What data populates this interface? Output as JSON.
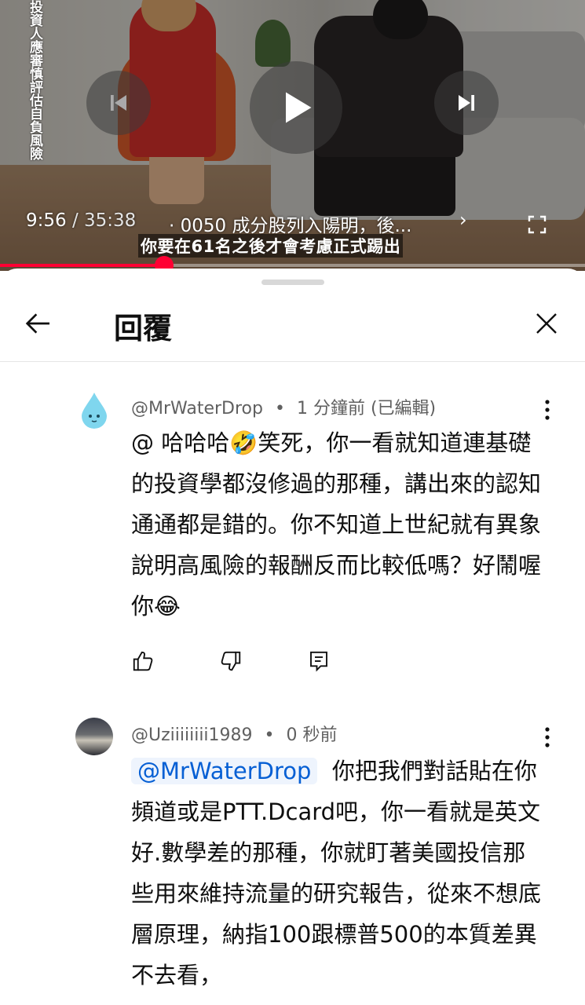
{
  "video": {
    "overlay_vertical_text": "投資人應審慎評估自負風險",
    "current_time": "9:56",
    "duration": " / 35:38",
    "chapter": "· 0050 成分股列入陽明，後...",
    "chapter_chevron": "›",
    "subtitle": "你要在61名之後才會考慮正式踢出",
    "progress_fraction": 0.28,
    "buttons": {
      "prev": "previous",
      "play": "play",
      "next": "next"
    }
  },
  "panel": {
    "title": "回覆"
  },
  "comments": [
    {
      "author": "@MrWaterDrop",
      "separator": "•",
      "time": "1 分鐘前 (已編輯)",
      "text": "@ 哈哈哈🤣笑死，你一看就知道連基礎的投資學都沒修過的那種，講出來的認知通通都是錯的。你不知道上世紀就有異象說明高風險的報酬反而比較低嗎？好鬧喔你😂"
    },
    {
      "author": "@Uziiiiiiii1989",
      "separator": "•",
      "time": "0 秒前",
      "mention": "@MrWaterDrop",
      "text": "你把我們對話貼在你頻道或是PTT.Dcard吧，你一看就是英文好.數學差的那種，你就盯著美國投信那些用來維持流量的研究報告，從來不想底層原理，納指100跟標普500的本質差異不去看，"
    }
  ],
  "colors": {
    "accent": "#ff0033",
    "link": "#065fd4"
  },
  "icons": [
    "back-arrow-icon",
    "close-icon",
    "like-icon",
    "dislike-icon",
    "reply-icon",
    "more-vert-icon",
    "fullscreen-icon",
    "play-icon",
    "previous-icon",
    "next-icon"
  ]
}
